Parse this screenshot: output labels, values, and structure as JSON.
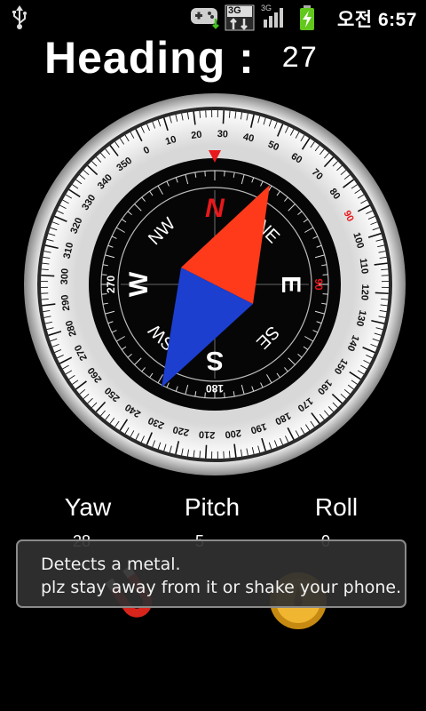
{
  "status_bar": {
    "network_type": "3G",
    "signal_type": "3G",
    "time": "오전 6:57",
    "icons": [
      "usb-icon",
      "gamepad-notification-icon",
      "data-3g-icon",
      "signal-bars-icon",
      "battery-charging-icon"
    ]
  },
  "heading": {
    "label": "Heading :",
    "value": "27"
  },
  "compass": {
    "heading_deg": 27,
    "marker_color": "#e8181c",
    "north_color": "#ff3a1a",
    "south_color": "#1c3fcf",
    "cardinals": {
      "N": "N",
      "E": "E",
      "S": "S",
      "W": "W"
    },
    "intercardinals": {
      "NE": "NE",
      "SE": "SE",
      "SW": "SW",
      "NW": "NW"
    },
    "inner_numbers": {
      "n90": "90",
      "n180": "180",
      "n270": "270"
    }
  },
  "readouts": {
    "yaw": {
      "label": "Yaw",
      "value": "28"
    },
    "pitch": {
      "label": "Pitch",
      "value": "5"
    },
    "roll": {
      "label": "Roll",
      "value": "0"
    }
  },
  "toast": {
    "line1": "Detects a metal.",
    "line2": "plz stay away from it or shake your phone."
  },
  "bottom_icons": {
    "left": "magnet-icon",
    "right": "calibrate-icon"
  }
}
